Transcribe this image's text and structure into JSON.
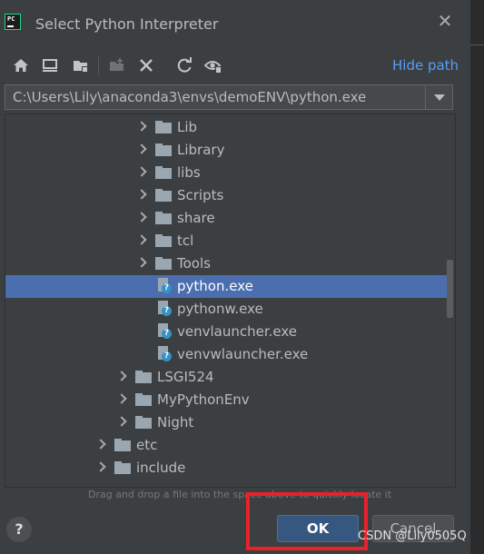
{
  "window": {
    "title": "Select Python Interpreter",
    "app_icon_text": "PC"
  },
  "toolbar": {
    "hide_path_label": "Hide path"
  },
  "path": {
    "value": "C:\\Users\\Lily\\anaconda3\\envs\\demoENV\\python.exe"
  },
  "tree": {
    "items": [
      {
        "label": "Lib",
        "type": "folder",
        "depth": 3,
        "expandable": true,
        "selected": false
      },
      {
        "label": "Library",
        "type": "folder",
        "depth": 3,
        "expandable": true,
        "selected": false
      },
      {
        "label": "libs",
        "type": "folder",
        "depth": 3,
        "expandable": true,
        "selected": false
      },
      {
        "label": "Scripts",
        "type": "folder",
        "depth": 3,
        "expandable": true,
        "selected": false
      },
      {
        "label": "share",
        "type": "folder",
        "depth": 3,
        "expandable": true,
        "selected": false
      },
      {
        "label": "tcl",
        "type": "folder",
        "depth": 3,
        "expandable": true,
        "selected": false
      },
      {
        "label": "Tools",
        "type": "folder",
        "depth": 3,
        "expandable": true,
        "selected": false
      },
      {
        "label": "python.exe",
        "type": "file",
        "depth": 3,
        "expandable": false,
        "selected": true
      },
      {
        "label": "pythonw.exe",
        "type": "file",
        "depth": 3,
        "expandable": false,
        "selected": false
      },
      {
        "label": "venvlauncher.exe",
        "type": "file",
        "depth": 3,
        "expandable": false,
        "selected": false
      },
      {
        "label": "venvwlauncher.exe",
        "type": "file",
        "depth": 3,
        "expandable": false,
        "selected": false
      },
      {
        "label": "LSGI524",
        "type": "folder",
        "depth": 2,
        "expandable": true,
        "selected": false
      },
      {
        "label": "MyPythonEnv",
        "type": "folder",
        "depth": 2,
        "expandable": true,
        "selected": false
      },
      {
        "label": "Night",
        "type": "folder",
        "depth": 2,
        "expandable": true,
        "selected": false
      },
      {
        "label": "etc",
        "type": "folder",
        "depth": 1,
        "expandable": true,
        "selected": false
      },
      {
        "label": "include",
        "type": "folder",
        "depth": 1,
        "expandable": true,
        "selected": false
      }
    ]
  },
  "hint": "Drag and drop a file into the space above to quickly locate it",
  "buttons": {
    "help": "?",
    "ok": "OK",
    "cancel": "Cancel"
  },
  "watermark": "CSDN @Lily0505Q",
  "colors": {
    "background": "#3c3f41",
    "selection": "#4b6eaf",
    "link": "#589df6",
    "ok_button": "#365880",
    "highlight_box": "#e8212a"
  }
}
